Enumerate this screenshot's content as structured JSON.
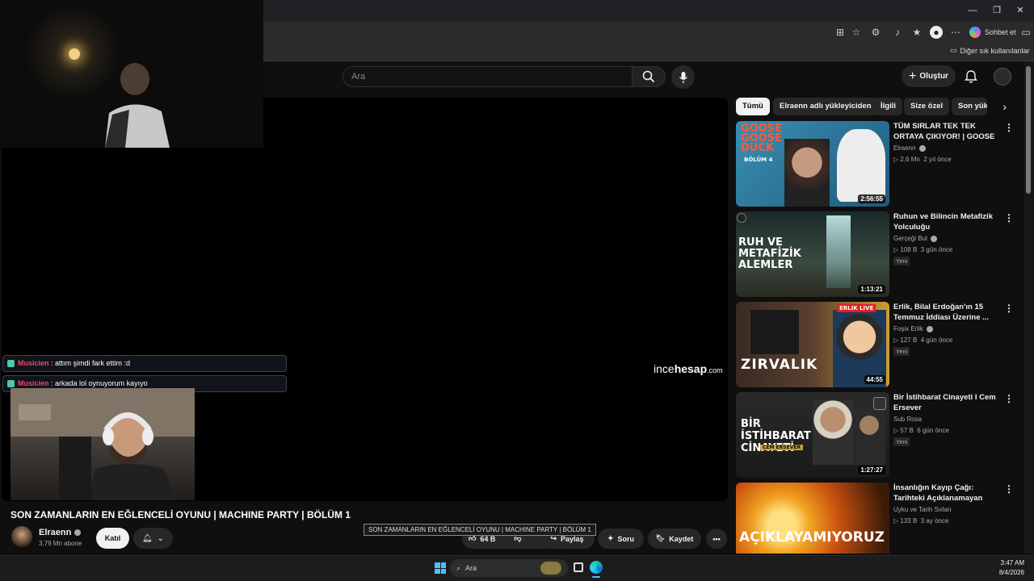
{
  "browser": {
    "chat_label": "Sohbet et",
    "other_bookmarks": "Diğer sık kullanılanlar"
  },
  "header": {
    "search_placeholder": "Ara",
    "create_label": "Oluştur"
  },
  "player": {
    "watermark_a": "ince",
    "watermark_b": "hesap",
    "watermark_c": ".com",
    "chat": [
      {
        "user": "Musicien",
        "text": ": attım şimdi fark ettim :d"
      },
      {
        "user": "Musicien",
        "text": ": arkada lol oynuyorum kayıyo"
      }
    ]
  },
  "video": {
    "title": "SON ZAMANLARIN EN EĞLENCELİ OYUNU | MACHINE PARTY | BÖLÜM 1",
    "tooltip": "SON ZAMANLARIN EN EĞLENCELİ OYUNU | MACHINE PARTY | BÖLÜM 1",
    "channel": "Elraenn",
    "subscribers": "3,79 Mn abone",
    "join": "Katıl",
    "likes": "64 B",
    "share": "Paylaş",
    "ask": "Soru",
    "save": "Kaydet"
  },
  "chips": [
    "Tümü",
    "Elraenn adlı yükleyiciden",
    "İlgili",
    "Size özel",
    "Son yük"
  ],
  "recommendations": [
    {
      "title": "TÜM SIRLAR TEK TEK ORTAYA ÇIKIYOR! | GOOSE GOOSE DU...",
      "channel": "Elraenn",
      "views": "2,6 Mn",
      "age": "2 yıl önce",
      "duration": "2:56:55",
      "badge": "",
      "thumb_text": "GOOSE GOOSE DUCK",
      "thumb_sub": "BÖLÜM 4"
    },
    {
      "title": "Ruhun ve Bilincin Metafizik Yolculuğu",
      "channel": "Gerçeği Bul",
      "views": "108 B",
      "age": "3 gün önce",
      "duration": "1:13:21",
      "badge": "Yeni",
      "thumb_text": "RUH VE METAFİZİK ALEMLER",
      "thumb_sub": ""
    },
    {
      "title": "Erlik, Bilal Erdoğan'ın 15 Temmuz İddiası Üzerine ...",
      "channel": "Foşix Erlik",
      "views": "127 B",
      "age": "4 gün önce",
      "duration": "44:55",
      "badge": "Yeni",
      "thumb_text": "ZIRVALIK",
      "thumb_sub": "ERLIK LIVE"
    },
    {
      "title": "Bir İstihbarat Cinayeti I Cem Ersever",
      "channel": "Sub Rosa",
      "views": "57 B",
      "age": "6 gün önce",
      "duration": "1:27:27",
      "badge": "Yeni",
      "thumb_text": "BİR İSTİHBARAT CİNAYETİ",
      "thumb_sub": "CEM ERSEVER"
    },
    {
      "title": "İnsanlığın Kayıp Çağı: Tarihteki Açıklanamayan Boşluklar | Uy...",
      "channel": "Uyku ve Tarih Sırları",
      "views": "133 B",
      "age": "3 ay önce",
      "duration": "",
      "badge": "",
      "thumb_text": "AÇIKLAYAMIYORUZ",
      "thumb_sub": ""
    }
  ],
  "taskbar": {
    "search": "Ara",
    "time": "3:47 AM",
    "date": "8/4/2026"
  }
}
